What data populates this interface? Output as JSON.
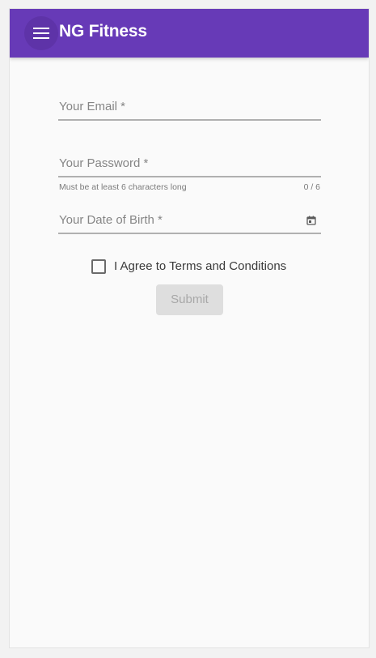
{
  "app": {
    "title": "NG Fitness",
    "accent_color": "#673ab7"
  },
  "toolbar": {
    "menu_icon": "menu-icon"
  },
  "form": {
    "email": {
      "label": "Your Email *",
      "value": ""
    },
    "password": {
      "label": "Your Password *",
      "value": "",
      "hint": "Must be at least 6 characters long",
      "counter": "0 / 6"
    },
    "dob": {
      "label": "Your Date of Birth *",
      "value": "",
      "icon": "calendar-icon"
    },
    "terms": {
      "label": "I Agree to Terms and Conditions",
      "checked": false
    },
    "submit": {
      "label": "Submit",
      "disabled": true
    }
  }
}
